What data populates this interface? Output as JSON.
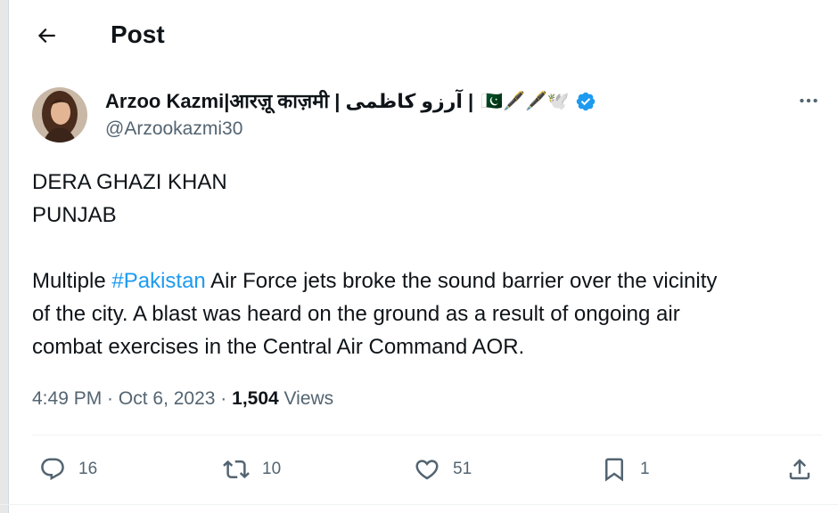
{
  "header": {
    "title": "Post",
    "back_icon": "arrow-left-icon"
  },
  "author": {
    "display_name": "Arzoo Kazmi|आरज़ू काज़मी | آرزو کاظمی |",
    "name_emoji": "🇵🇰🖋️🖋️🕊️",
    "handle": "@Arzookazmi30",
    "verified": true,
    "verified_color": "#1d9bf0"
  },
  "tweet": {
    "line1": "DERA GHAZI KHAN",
    "line2": "PUNJAB",
    "body_prefix": "Multiple ",
    "hashtag": "#Pakistan",
    "body_line1_rest": " Air Force jets broke the sound barrier over the vicinity",
    "body_line2": "of the city. A blast was heard on the ground as a result of ongoing air",
    "body_line3": "combat exercises in the Central Air Command AOR.",
    "link_color": "#1d9bf0"
  },
  "meta": {
    "time": "4:49 PM",
    "sep1": " · ",
    "date": "Oct 6, 2023",
    "sep2": " · ",
    "views_count": "1,504",
    "views_label": " Views"
  },
  "actions": {
    "replies": "16",
    "reposts": "10",
    "likes": "51",
    "bookmarks": "1"
  }
}
